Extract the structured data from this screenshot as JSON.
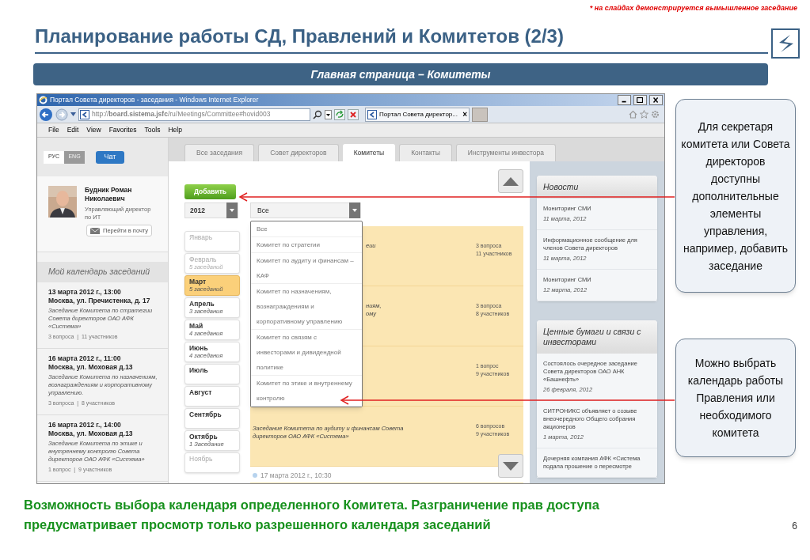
{
  "note": "* на слайдах демонстрируется вымышленное заседание",
  "title": "Планирование работы СД, Правлений и Комитетов (2/3)",
  "banner": "Главная страница – Комитеты",
  "browser": {
    "title": "Портал Совета директоров - заседания - Windows Internet Explorer",
    "url": "http://**board.sistema.jsfc**/ru/Meetings/Committee#hovid003",
    "tab": "Портал Совета директор...",
    "tab_close": "×",
    "menu": [
      "File",
      "Edit",
      "View",
      "Favorites",
      "Tools",
      "Help"
    ]
  },
  "sidebar": {
    "languages": [
      {
        "label": "РУС",
        "selected": true
      },
      {
        "label": "ENG",
        "selected": false
      }
    ],
    "chat": "Чат",
    "user": {
      "name": "Будник Роман Николаевич",
      "role": "Управляющий директор по ИТ",
      "mail_button": "Перейти в почту"
    },
    "calendar_title": "Мой календарь заседаний",
    "events": [
      {
        "date": "13 марта 2012 г., 13:00",
        "place": "Москва, ул. Пречистенка, д. 17",
        "description": "Заседание Комитета по стратегии Совета директоров ОАО АФК «Система»",
        "stats": "3 вопроса  |  11 участников"
      },
      {
        "date": "16 марта 2012 г., 11:00",
        "place": "Москва, ул. Моховая д.13",
        "description": "Заседание Комитета по назначениям, вознаграждениям и корпоративному управлению.",
        "stats": "3 вопроса  |  8 участников"
      },
      {
        "date": "16 марта 2012 г., 14:00",
        "place": "Москва, ул. Моховая д.13",
        "description": "Заседание Комитета по этике и внутреннему контролю Совета директоров ОАО АФК «Система»",
        "stats": "1 вопрос  |  9 участников"
      }
    ]
  },
  "tabs": [
    {
      "label": "Все заседания",
      "selected": false
    },
    {
      "label": "Совет директоров",
      "selected": false
    },
    {
      "label": "Комитеты",
      "selected": true
    },
    {
      "label": "Контакты",
      "selected": false
    },
    {
      "label": "Инструменты инвестора",
      "selected": false
    }
  ],
  "add_button": "Добавить",
  "year": "2012",
  "filter": "Все",
  "dropdown": [
    "Все",
    "Комитет по стратегии",
    "Комитет по аудиту и финансам – КАФ",
    "Комитет по назначениям, вознаграждениям и корпоративному управлению",
    "Комитет по связям с инвесторами и дивидендной политике",
    "Комитет по этике и внутреннему контролю"
  ],
  "months": [
    {
      "name": "Январь",
      "selected": false,
      "disabled": true
    },
    {
      "name": "Февраль",
      "count": "5 заседаний",
      "selected": false,
      "disabled": true
    },
    {
      "name": "Март",
      "count": "5 заседаний",
      "selected": true,
      "disabled": false
    },
    {
      "name": "Апрель",
      "count": "3 заседания",
      "selected": false,
      "disabled": false
    },
    {
      "name": "Май",
      "count": "4 заседания",
      "selected": false,
      "disabled": false
    },
    {
      "name": "Июнь",
      "count": "4 заседания",
      "selected": false,
      "disabled": false
    },
    {
      "name": "Июль",
      "selected": false,
      "disabled": false
    },
    {
      "name": "Август",
      "selected": false,
      "disabled": false
    },
    {
      "name": "Сентябрь",
      "selected": false,
      "disabled": false
    },
    {
      "name": "Октябрь",
      "count": "1 Заседание",
      "selected": false,
      "disabled": false
    },
    {
      "name": "Ноябрь",
      "selected": false,
      "disabled": true
    }
  ],
  "meetings": [
    {
      "fragments": [
        "еии"
      ],
      "questions": "3 вопроса",
      "participants": "11 участников"
    },
    {
      "fragments": [
        "ниям,",
        "ому"
      ],
      "questions": "3 вопроса",
      "participants": "8 участников"
    },
    {
      "questions": "1 вопрос",
      "participants": "9 участников"
    },
    {
      "description": "Заседание Комитета по аудиту и финансам Совета директоров ОАО АФК «Система»",
      "questions": "6 вопросов",
      "participants": "9 участников"
    }
  ],
  "next_meeting": "17 марта 2012 г., 10:30",
  "news": {
    "title": "Новости",
    "items": [
      {
        "title": "Мониторинг СМИ",
        "date": "11 марта, 2012"
      },
      {
        "title": "Информационное сообщение для членов Совета директоров",
        "date": "11 марта, 2012"
      },
      {
        "title": "Мониторинг СМИ",
        "date": "12 марта, 2012"
      }
    ]
  },
  "investors": {
    "title": "Ценные бумаги и связи с инвесторами",
    "items": [
      {
        "title": "Состоялось очередное заседание Совета директоров ОАО АНК «Башнефть»",
        "date": "26 февраля, 2012"
      },
      {
        "title": "СИТРОНИКС объявляет о созыве внеочередного Общего собрания акционеров",
        "date": "1 марта, 2012"
      },
      {
        "title": "Дочерняя компания АФК «Система подала прошение о пересмотре"
      }
    ]
  },
  "callouts": [
    "Для секретаря комитета или Совета директоров доступны дополнительные элементы управления, например, добавить заседание",
    "Можно выбрать календарь работы Правления или необходимого комитета"
  ],
  "footer": [
    "Возможность выбора календаря определенного Комитета. Разграничение прав доступа",
    "предусматривает просмотр только разрешенного календаря заседаний"
  ],
  "page_number": "6"
}
